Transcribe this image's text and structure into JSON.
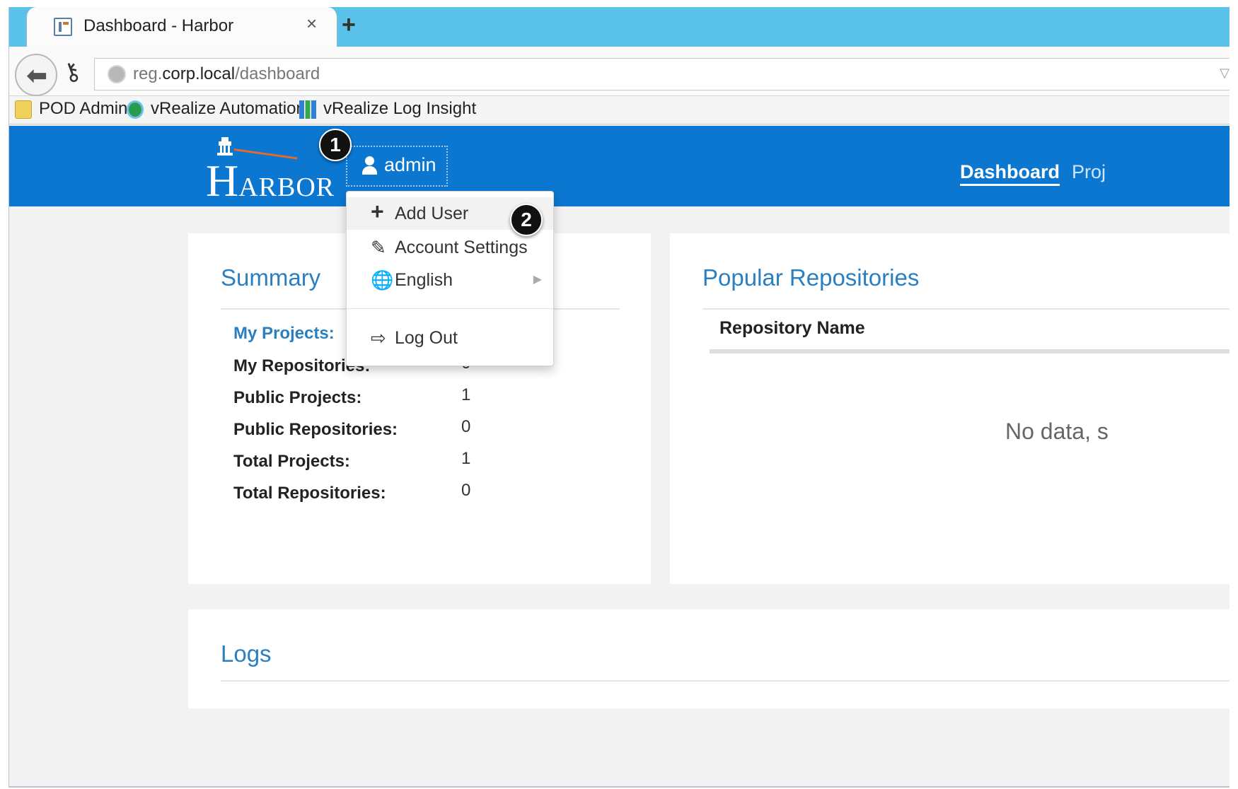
{
  "browser": {
    "tab_title": "Dashboard - Harbor",
    "tab_close": "×",
    "new_tab": "+",
    "back": "⬅",
    "url": {
      "pre": "reg.",
      "host": "corp.local",
      "path": "/dashboard"
    },
    "url_dropdown": "▽",
    "bookmarks": [
      "POD Admin",
      "vRealize Automation",
      "vRealize Log Insight"
    ]
  },
  "header": {
    "logo": {
      "first": "H",
      "rest": "ARBOR"
    },
    "user": "admin",
    "nav": {
      "dashboard": "Dashboard",
      "projects": "Proj"
    }
  },
  "dropdown": {
    "items": [
      {
        "icon": "+",
        "label": "Add User"
      },
      {
        "icon": "✎",
        "label": "Account Settings"
      },
      {
        "icon": "🌐",
        "label": "English"
      },
      {
        "icon": "⇨",
        "label": "Log Out"
      }
    ],
    "submenu_arrow": "▶"
  },
  "summary": {
    "title": "Summary",
    "rows": [
      {
        "label": "My Projects:",
        "value": ""
      },
      {
        "label": "My Repositories:",
        "value": "0"
      },
      {
        "label": "Public Projects:",
        "value": "1"
      },
      {
        "label": "Public Repositories:",
        "value": "0"
      },
      {
        "label": "Total Projects:",
        "value": "1"
      },
      {
        "label": "Total Repositories:",
        "value": "0"
      }
    ]
  },
  "popular": {
    "title": "Popular Repositories",
    "column": "Repository Name",
    "empty": "No data, s"
  },
  "logs": {
    "title": "Logs"
  },
  "callouts": [
    "1",
    "2"
  ],
  "colors": {
    "accent": "#0b77d0",
    "link": "#2a7fc1",
    "tabbar": "#5bc3ea"
  }
}
